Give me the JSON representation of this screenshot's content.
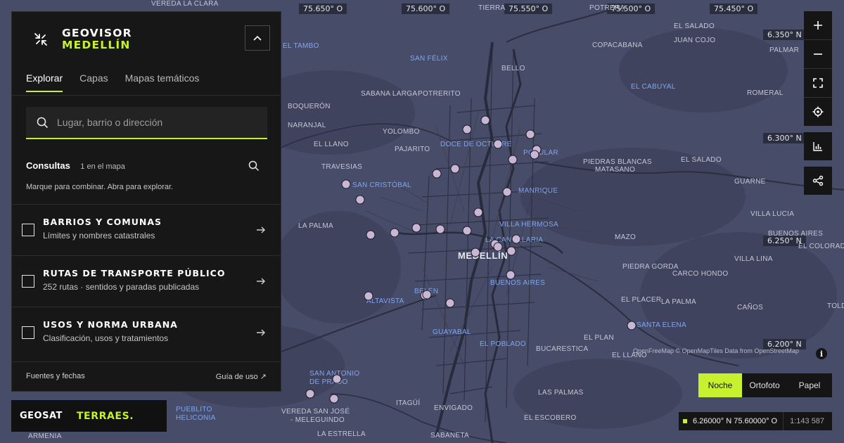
{
  "panel": {
    "brand_line1": "GEOVISOR",
    "brand_line2": "MEDELLÍN",
    "tabs": [
      {
        "label": "Explorar",
        "active": true
      },
      {
        "label": "Capas",
        "active": false
      },
      {
        "label": "Mapas temáticos",
        "active": false
      }
    ],
    "search_placeholder": "Lugar, barrio o dirección",
    "consultas": {
      "title": "Consultas",
      "count": "1 en el mapa",
      "hint": "Marque para combinar. Abra para explorar."
    },
    "layers": [
      {
        "title": "BARRIOS Y COMUNAS",
        "subtitle": "Límites y nombres catastrales",
        "checked": false
      },
      {
        "title": "RUTAS DE TRANSPORTE PÚBLICO",
        "subtitle": "252 rutas · sentidos y paradas publicadas",
        "checked": false
      },
      {
        "title": "USOS Y NORMA URBANA",
        "subtitle": "Clasificación, usos y tratamientos",
        "checked": false
      }
    ],
    "footer_left": "Fuentes y fechas",
    "footer_right": "Guía de uso ↗"
  },
  "logos": {
    "geosat": "GEOSAT",
    "terraes": "TERRAES."
  },
  "map": {
    "longitude_labels": [
      "75.650° O",
      "75.600° O",
      "75.550° O",
      "75.500° O",
      "75.450° O"
    ],
    "latitude_labels": [
      "6.350° N",
      "6.300° N",
      "6.250° N",
      "6.200° N"
    ],
    "places": {
      "vereda_la_clara": "VEREDA LA CLARA",
      "tierra": "TIERRA",
      "potrera": "POTRERA",
      "el_salado_n": "EL SALADO",
      "juan_cojo": "JUAN COJO",
      "el_tambo": "EL TAMBO",
      "san_felix": "SAN FÉLIX",
      "copacabana": "COPACABANA",
      "palmar": "PALMAR",
      "bello": "BELLO",
      "el_cabuyal": "EL CABUYAL",
      "sabana_larga": "SABANA LARGA",
      "potrerito": "POTRERITO",
      "romeral": "ROMERAL",
      "boqueron": "BOQUERÓN",
      "naranjal": "NARANJAL",
      "yolombo": "YOLOMBO",
      "el_llano_w": "EL LLANO",
      "pajarito": "PAJARITO",
      "doce_de_octubre": "DOCE DE OCTUBRE",
      "popular": "POPULAR",
      "el_salado_e": "EL SALADO",
      "travesias": "TRAVESIAS",
      "piedras_blancas": "PIEDRAS BLANCAS",
      "matasano": "MATASANO",
      "guarne": "GUARNE",
      "san_cristobal": "SAN CRISTÓBAL",
      "manrique": "MANRIQUE",
      "villa_lucia": "VILLA LUCIA",
      "la_palma_w": "LA PALMA",
      "villa_hermosa": "VILLA HERMOSA",
      "buenos_aires_e": "BUENOS AIRES",
      "mazo": "MAZO",
      "la_candelaria": "LA CANDELARIA",
      "el_colorado": "EL COLORADO",
      "medellin": "MEDELLÍN",
      "villa_lina": "VILLA LINA",
      "piedra_gorda": "PIEDRA GORDA",
      "carco_hondo": "CARCO HONDO",
      "buenos_aires": "BUENOS AIRES",
      "belen": "BELÉN",
      "altavista": "ALTAVISTA",
      "el_placer": "EL PLACER",
      "la_palma_e": "LA PALMA",
      "canos": "CAÑOS",
      "toldas": "TOLDAS",
      "guayabal": "GUAYABAL",
      "santa_elena": "SANTA ELENA",
      "el_poblado": "EL POBLADO",
      "bucarestica": "BUCARESTICA",
      "el_plan": "EL PLAN",
      "el_llano_e": "EL LLANO",
      "san_antonio_de_prado_1": "SAN ANTONIO",
      "san_antonio_de_prado_2": "DE PRADO",
      "itagui": "ITAGÜÍ",
      "envigado": "ENVIGADO",
      "las_palmas": "LAS PALMAS",
      "pueblito_1": "PUEBLITO",
      "pueblito_2": "HELICONIA",
      "vereda_san_jose_1": "VEREDA SAN JOSÉ",
      "vereda_san_jose_2": "- MELEGUINDO",
      "el_escobero": "EL ESCOBERO",
      "armenia": "ARMENIA",
      "la_estrella": "LA ESTRELLA",
      "sabaneta": "SABANETA"
    },
    "attribution": "OpenFreeMap © OpenMapTiles Data from OpenStreetMap",
    "basemaps": [
      {
        "label": "Noche",
        "active": true
      },
      {
        "label": "Ortofoto",
        "active": false
      },
      {
        "label": "Papel",
        "active": false
      }
    ],
    "cursor_coordinates": "6.26000° N 75.60000° O",
    "scale": "1:143 587"
  },
  "colors": {
    "accent": "#c7f02e",
    "panel": "#171717",
    "map": "#474c68",
    "poi": "#c8b6d4"
  }
}
